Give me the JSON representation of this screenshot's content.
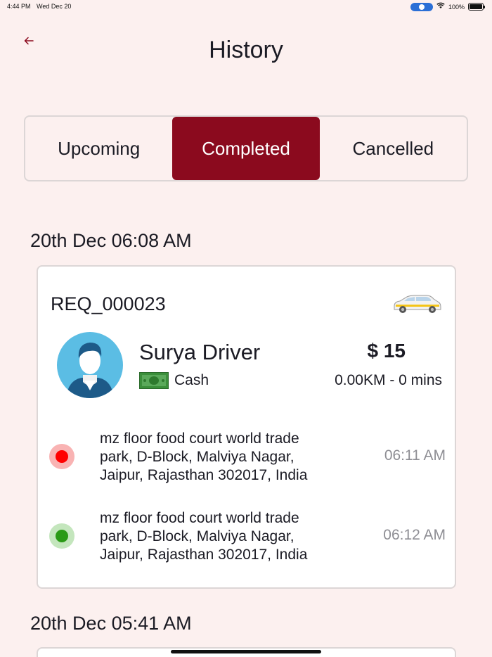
{
  "status_bar": {
    "time": "4:44 PM",
    "date": "Wed Dec 20",
    "battery": "100%"
  },
  "header": {
    "back_icon": "back-arrow-icon",
    "title": "History"
  },
  "tabs": [
    {
      "label": "Upcoming",
      "active": false
    },
    {
      "label": "Completed",
      "active": true
    },
    {
      "label": "Cancelled",
      "active": false
    }
  ],
  "bookings": [
    {
      "date_heading": "20th Dec 06:08 AM",
      "request_id": "REQ_000023",
      "vehicle_icon": "taxi-car-icon",
      "driver_name": "Surya Driver",
      "payment_icon": "cash-icon",
      "payment_method": "Cash",
      "fare": "$ 15",
      "trip_meta": "0.00KM - 0 mins",
      "stops": [
        {
          "type": "pickup",
          "address": "mz floor food court world trade park, D-Block, Malviya Nagar, Jaipur, Rajasthan 302017, India",
          "time": "06:11 AM"
        },
        {
          "type": "drop",
          "address": "mz floor food court world trade park, D-Block, Malviya Nagar, Jaipur, Rajasthan 302017, India",
          "time": "06:12 AM"
        }
      ]
    },
    {
      "date_heading": "20th Dec 05:41 AM"
    }
  ],
  "colors": {
    "background": "#fcf0ef",
    "accent": "#8b0a1e",
    "pickup_dot": "#ff0000",
    "drop_dot": "#2a9a16",
    "muted_text": "#8e8e94"
  }
}
